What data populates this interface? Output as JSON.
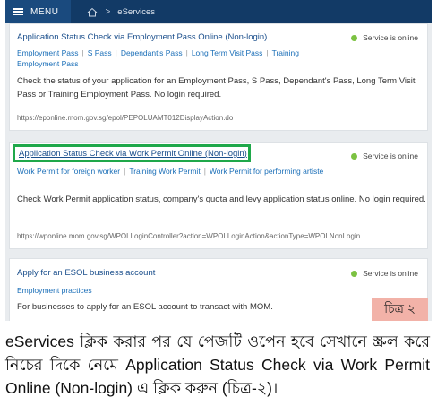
{
  "topbar": {
    "menu_label": "MENU",
    "breadcrumb_current": "eServices"
  },
  "cards": [
    {
      "title": "Application Status Check via Employment Pass Online (Non-login)",
      "status": "Service is online",
      "tags": [
        "Employment Pass",
        "S Pass",
        "Dependant's Pass",
        "Long Term Visit Pass",
        "Training Employment Pass"
      ],
      "description": "Check the status of your application for an Employment Pass, S Pass, Dependant's Pass, Long Term Visit Pass or Training Employment Pass. No login required.",
      "url": "https://eponline.mom.gov.sg/epol/PEPOLUAMT012DisplayAction.do"
    },
    {
      "title": "Application Status Check via Work Permit Online (Non-login)",
      "status": "Service is online",
      "tags": [
        "Work Permit for foreign worker",
        "Training Work Permit",
        "Work Permit for performing artiste"
      ],
      "description": "Check Work Permit application status, company's quota and levy application status online. No login required.",
      "url": "https://wponline.mom.gov.sg/WPOLLoginController?action=WPOLLoginAction&actionType=WPOLNonLogin"
    },
    {
      "title": "Apply for an ESOL business account",
      "status": "Service is online",
      "tags": [
        "Employment practices"
      ],
      "description": "For businesses to apply for an ESOL account to transact with MOM.",
      "url": ""
    }
  ],
  "figure_label": "চিত্র ২",
  "caption": "eServices ক্লিক করার পর যে পেজটি ওপেন হবে সেখানে স্ক্রল করে নিচের দিকে নেমে Application Status Check via Work Permit Online (Non-login) এ ক্লিক করুন (চিত্র-২)।",
  "colors": {
    "topbar": "#123a66",
    "link": "#1b4f8c",
    "highlight": "#1fa84a",
    "online_dot": "#7cc242",
    "badge": "#f2b2a8"
  }
}
